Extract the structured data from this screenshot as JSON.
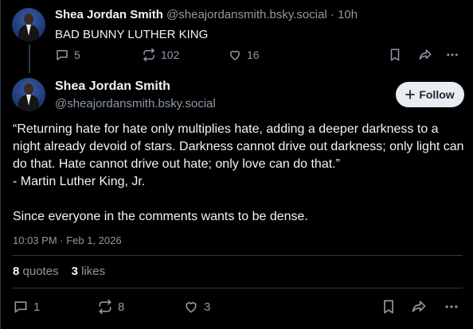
{
  "parent_post": {
    "author_name": "Shea Jordan Smith",
    "handle": "@sheajordansmith.bsky.social",
    "separator": "·",
    "age": "10h",
    "text": "BAD BUNNY LUTHER KING",
    "reply_count": "5",
    "repost_count": "102",
    "like_count": "16"
  },
  "main_post": {
    "author_name": "Shea Jordan Smith",
    "handle": "@sheajordansmith.bsky.social",
    "follow_label": "Follow",
    "body": "“Returning hate for hate only multiplies hate, adding a deeper darkness to a night already devoid of stars. Darkness cannot drive out darkness; only light can do that. Hate cannot drive out hate; only love can do that.”\n- Martin Luther King, Jr.\n\nSince everyone in the comments wants to be dense.",
    "timestamp": "10:03 PM · Feb 1, 2026",
    "quotes_count": "8",
    "quotes_label": "quotes",
    "likes_count": "3",
    "likes_label": "likes",
    "reply_count": "1",
    "repost_count": "8",
    "like_count": "3"
  },
  "colors": {
    "background": "#000000",
    "muted": "#8d99a6",
    "divider": "#2e3a4a",
    "follow_bg": "#e9edf1"
  },
  "icons": [
    "reply-icon",
    "repost-icon",
    "like-icon",
    "bookmark-icon",
    "share-icon",
    "more-icon",
    "plus-icon"
  ]
}
